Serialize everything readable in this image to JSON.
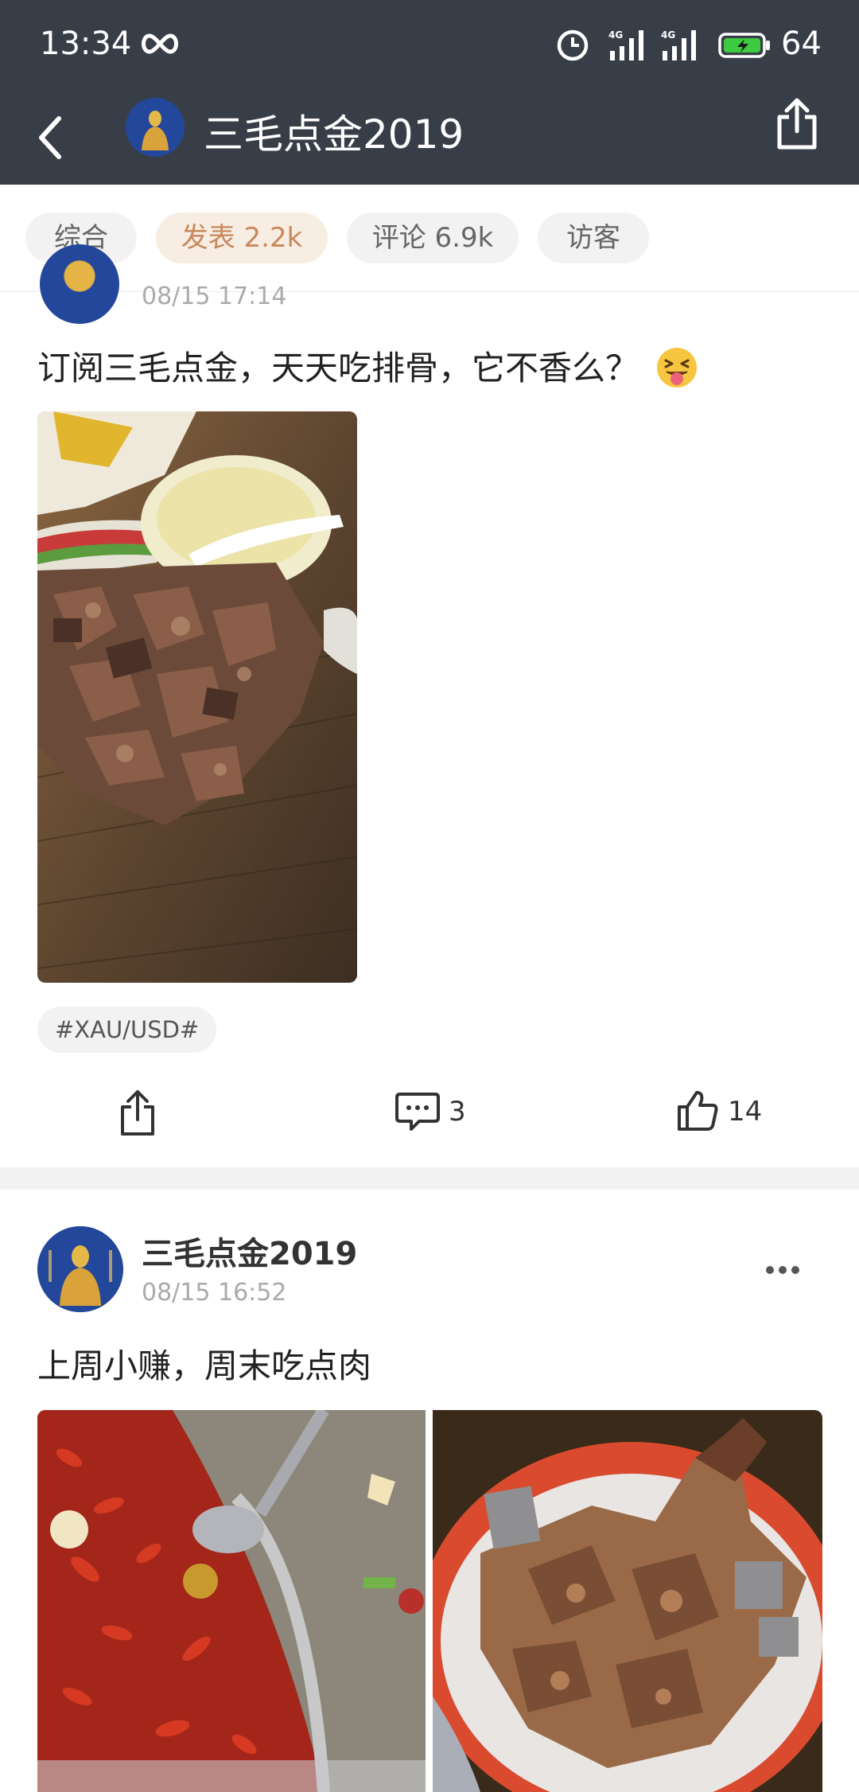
{
  "status_bar": {
    "time": "13:34",
    "network_1": "4G",
    "network_2": "4G",
    "battery": "64",
    "icons": [
      "loop-icon",
      "alarm-icon",
      "signal-icon",
      "signal-icon",
      "battery-charging-icon"
    ]
  },
  "header": {
    "title": "三毛点金2019",
    "back_icon": "back-arrow-icon",
    "share_icon": "share-icon"
  },
  "tabs": [
    {
      "label": "综合",
      "active": false
    },
    {
      "label": "发表 2.2k",
      "active": true
    },
    {
      "label": "评论 6.9k",
      "active": false
    },
    {
      "label": "访客",
      "active": false
    }
  ],
  "post1": {
    "time": "08/15 17:14",
    "text": "订阅三毛点金，天天吃排骨，它不香么？",
    "emoji": "grinning-squinting-tongue-emoji",
    "hashtag": "#XAU/USD#",
    "comments": "3",
    "likes": "14"
  },
  "post2": {
    "author": "三毛点金2019",
    "time": "08/15 16:52",
    "text": "上周小赚，周末吃点肉"
  },
  "colors": {
    "header_bg": "#383e48",
    "tab_active_bg": "#f7ede3",
    "tab_active_text": "#c9885c",
    "separator": "#f2f2f2"
  }
}
